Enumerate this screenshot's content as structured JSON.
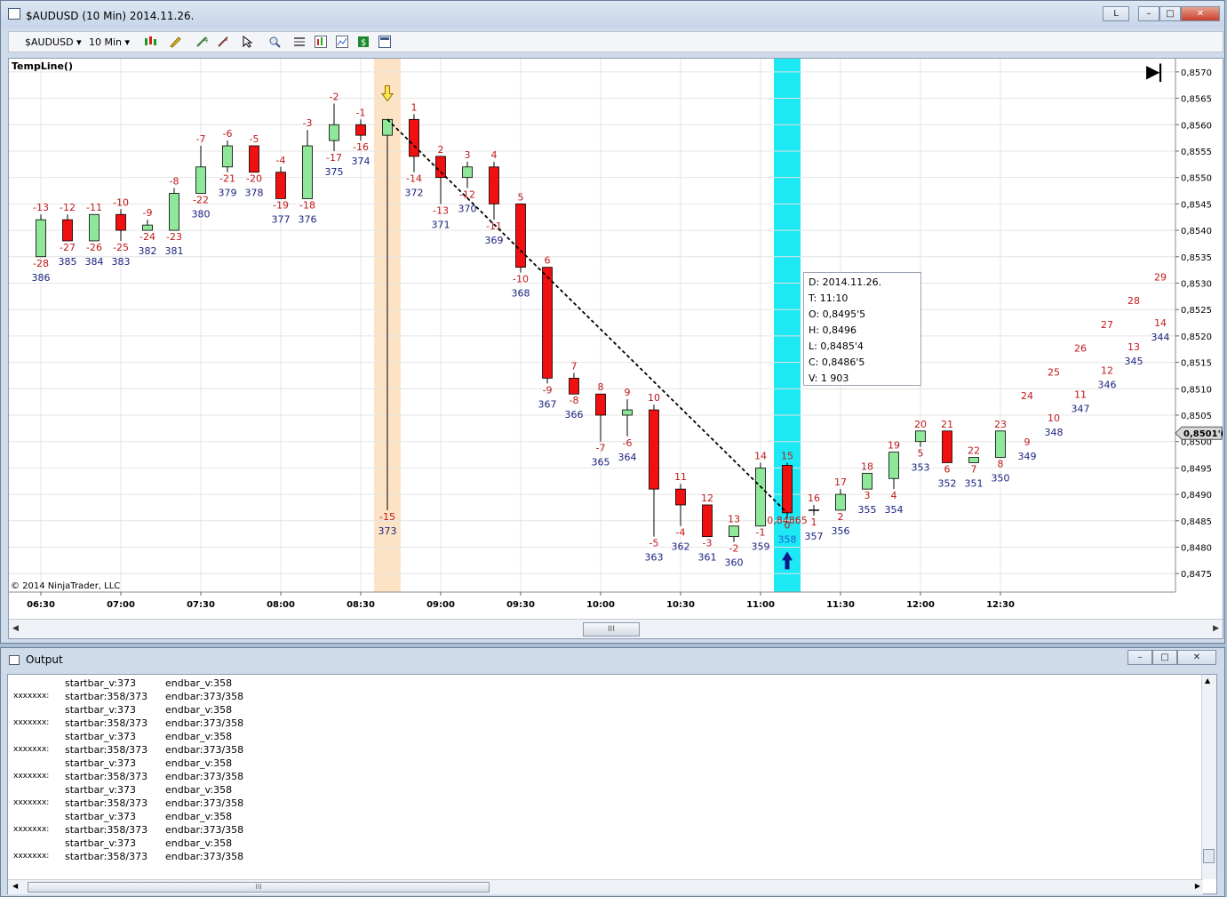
{
  "window": {
    "title": "$AUDUSD (10 Min)  2014.11.26.",
    "badge": "L",
    "minimize": "–",
    "maximize": "□",
    "close": "✕"
  },
  "toolbar": {
    "instrument": "$AUDUSD",
    "interval": "10 Min",
    "icons": [
      "candlestick-icon",
      "pencil-icon",
      "zoom-in-icon",
      "zoom-out-icon",
      "cursor-icon",
      "magnifier-icon",
      "properties-icon",
      "bars-icon",
      "indicator-icon",
      "strategy-icon",
      "dollar-icon",
      "data-box-icon"
    ]
  },
  "chart": {
    "indicator": "TempLine()",
    "copyright": "© 2014 NinjaTrader, LLC",
    "go_to_end": "▶|",
    "scroll_grip": "III",
    "info_box": [
      "D: 2014.11.26.",
      "T: 11:10",
      "O: 0,8495'5",
      "H: 0,8496",
      "L: 0,8485'4",
      "C: 0,8486'5",
      "V: 1 903"
    ],
    "line_label": "0,84865",
    "price_marker": "0,8501'6"
  },
  "chart_data": {
    "type": "candlestick",
    "x_labels": [
      "06:30",
      "07:00",
      "07:30",
      "08:00",
      "08:30",
      "09:00",
      "09:30",
      "10:00",
      "10:30",
      "11:00",
      "11:30",
      "12:00",
      "12:30"
    ],
    "y_ticks": [
      "0,8570",
      "0,8565",
      "0,8560",
      "0,8555",
      "0,8550",
      "0,8545",
      "0,8540",
      "0,8535",
      "0,8530",
      "0,8525",
      "0,8520",
      "0,8515",
      "0,8510",
      "0,8505",
      "0,8500",
      "0,8495",
      "0,8490",
      "0,8485",
      "0,8480",
      "0,8475"
    ],
    "ylim": [
      0.84715,
      0.85725
    ],
    "grid": true,
    "bars": [
      {
        "bar": 386,
        "o": 0.8535,
        "h": 0.8543,
        "l": 0.8535,
        "c": 0.8542,
        "top": "-13",
        "bot": "-28"
      },
      {
        "bar": 385,
        "o": 0.8542,
        "h": 0.8543,
        "l": 0.8538,
        "c": 0.8538,
        "top": "-12",
        "bot": "-27"
      },
      {
        "bar": 384,
        "o": 0.8538,
        "h": 0.8543,
        "l": 0.8538,
        "c": 0.8543,
        "top": "-11",
        "bot": "-26"
      },
      {
        "bar": 383,
        "o": 0.8543,
        "h": 0.8544,
        "l": 0.8538,
        "c": 0.854,
        "top": "-10",
        "bot": "-25"
      },
      {
        "bar": 382,
        "o": 0.854,
        "h": 0.8542,
        "l": 0.854,
        "c": 0.8541,
        "top": "-9",
        "bot": "-24"
      },
      {
        "bar": 381,
        "o": 0.854,
        "h": 0.8548,
        "l": 0.854,
        "c": 0.8547,
        "top": "-8",
        "bot": "-23"
      },
      {
        "bar": 380,
        "o": 0.8547,
        "h": 0.8556,
        "l": 0.8547,
        "c": 0.8552,
        "top": "-7",
        "bot": "-22"
      },
      {
        "bar": 379,
        "o": 0.8552,
        "h": 0.8557,
        "l": 0.8551,
        "c": 0.8556,
        "top": "-6",
        "bot": "-21"
      },
      {
        "bar": 378,
        "o": 0.8556,
        "h": 0.8556,
        "l": 0.8551,
        "c": 0.8551,
        "top": "-5",
        "bot": "-20"
      },
      {
        "bar": 377,
        "o": 0.8551,
        "h": 0.8552,
        "l": 0.8546,
        "c": 0.8546,
        "top": "-4",
        "bot": "-19"
      },
      {
        "bar": 376,
        "o": 0.8546,
        "h": 0.8559,
        "l": 0.8546,
        "c": 0.8556,
        "top": "-3",
        "bot": "-18"
      },
      {
        "bar": 375,
        "o": 0.8557,
        "h": 0.8564,
        "l": 0.8555,
        "c": 0.856,
        "top": "-2",
        "bot": "-17"
      },
      {
        "bar": 374,
        "o": 0.856,
        "h": 0.8561,
        "l": 0.8557,
        "c": 0.8558,
        "top": "-1",
        "bot": "-16"
      },
      {
        "bar": 373,
        "o": 0.8558,
        "h": 0.8561,
        "l": 0.8487,
        "c": 0.8561,
        "top": "",
        "bot": "-15"
      },
      {
        "bar": 372,
        "o": 0.8561,
        "h": 0.8562,
        "l": 0.8551,
        "c": 0.8554,
        "top": "1",
        "bot": "-14"
      },
      {
        "bar": 371,
        "o": 0.8554,
        "h": 0.8554,
        "l": 0.8545,
        "c": 0.855,
        "top": "2",
        "bot": "-13"
      },
      {
        "bar": 370,
        "o": 0.855,
        "h": 0.8553,
        "l": 0.8548,
        "c": 0.8552,
        "top": "3",
        "bot": "-12"
      },
      {
        "bar": 369,
        "o": 0.8552,
        "h": 0.8553,
        "l": 0.8542,
        "c": 0.8545,
        "top": "4",
        "bot": "-11"
      },
      {
        "bar": 368,
        "o": 0.8545,
        "h": 0.8545,
        "l": 0.8532,
        "c": 0.8533,
        "top": "5",
        "bot": "-10"
      },
      {
        "bar": 367,
        "o": 0.8533,
        "h": 0.8533,
        "l": 0.8511,
        "c": 0.8512,
        "top": "6",
        "bot": "-9"
      },
      {
        "bar": 366,
        "o": 0.8512,
        "h": 0.8513,
        "l": 0.8509,
        "c": 0.8509,
        "top": "7",
        "bot": "-8"
      },
      {
        "bar": 365,
        "o": 0.8509,
        "h": 0.8509,
        "l": 0.85,
        "c": 0.8505,
        "top": "8",
        "bot": "-7"
      },
      {
        "bar": 364,
        "o": 0.8505,
        "h": 0.8508,
        "l": 0.8501,
        "c": 0.8506,
        "top": "9",
        "bot": "-6"
      },
      {
        "bar": 363,
        "o": 0.8506,
        "h": 0.8507,
        "l": 0.8482,
        "c": 0.8491,
        "top": "10",
        "bot": "-5"
      },
      {
        "bar": 362,
        "o": 0.8491,
        "h": 0.8492,
        "l": 0.8484,
        "c": 0.8488,
        "top": "11",
        "bot": "-4"
      },
      {
        "bar": 361,
        "o": 0.8488,
        "h": 0.8488,
        "l": 0.8482,
        "c": 0.8482,
        "top": "12",
        "bot": "-3"
      },
      {
        "bar": 360,
        "o": 0.8482,
        "h": 0.8484,
        "l": 0.8481,
        "c": 0.8484,
        "top": "13",
        "bot": "-2"
      },
      {
        "bar": 359,
        "o": 0.8484,
        "h": 0.8496,
        "l": 0.8484,
        "c": 0.8495,
        "top": "14",
        "bot": "-1"
      },
      {
        "bar": 358,
        "o": 0.84955,
        "h": 0.8496,
        "l": 0.84854,
        "c": 0.84865,
        "top": "15",
        "bot": "0"
      },
      {
        "bar": 357,
        "o": 0.8487,
        "h": 0.8488,
        "l": 0.8486,
        "c": 0.8487,
        "top": "16",
        "bot": "1"
      },
      {
        "bar": 356,
        "o": 0.8487,
        "h": 0.8491,
        "l": 0.8487,
        "c": 0.849,
        "top": "17",
        "bot": "2"
      },
      {
        "bar": 355,
        "o": 0.8491,
        "h": 0.8494,
        "l": 0.8491,
        "c": 0.8494,
        "top": "18",
        "bot": "3"
      },
      {
        "bar": 354,
        "o": 0.8493,
        "h": 0.8498,
        "l": 0.8491,
        "c": 0.8498,
        "top": "19",
        "bot": "4"
      },
      {
        "bar": 353,
        "o": 0.85,
        "h": 0.8502,
        "l": 0.8499,
        "c": 0.8502,
        "top": "20",
        "bot": "5"
      },
      {
        "bar": 352,
        "o": 0.8502,
        "h": 0.8502,
        "l": 0.8496,
        "c": 0.8496,
        "top": "21",
        "bot": "6"
      },
      {
        "bar": 351,
        "o": 0.8496,
        "h": 0.8497,
        "l": 0.8496,
        "c": 0.8497,
        "top": "22",
        "bot": "7"
      },
      {
        "bar": 350,
        "o": 0.8497,
        "h": 0.8502,
        "l": 0.8497,
        "c": 0.8502,
        "top": "23",
        "bot": "8"
      }
    ],
    "future": [
      {
        "bar": "349",
        "top": "24",
        "bot": "9"
      },
      {
        "bar": "348",
        "top": "25",
        "bot": "10"
      },
      {
        "bar": "347",
        "top": "26",
        "bot": "11"
      },
      {
        "bar": "346",
        "top": "27",
        "bot": "12"
      },
      {
        "bar": "345",
        "top": "28",
        "bot": "13"
      },
      {
        "bar": "344",
        "top": "29",
        "bot": "14"
      }
    ],
    "trend_line": {
      "from_bar": 373,
      "from_price": 0.8561,
      "to_bar": 358,
      "to_price": 0.84865
    },
    "highlight_bars": [
      {
        "bar": 373,
        "color": "#fde3c6"
      },
      {
        "bar": 358,
        "color": "#1de9f5"
      }
    ],
    "last_price": 0.85016
  },
  "output": {
    "title": "Output",
    "lines": [
      [
        "",
        "startbar_v:373",
        "endbar_v:358"
      ],
      [
        "xxxxxxx:",
        "startbar:358/373",
        "endbar:373/358"
      ],
      [
        "",
        "startbar_v:373",
        "endbar_v:358"
      ],
      [
        "xxxxxxx:",
        "startbar:358/373",
        "endbar:373/358"
      ],
      [
        "",
        "startbar_v:373",
        "endbar_v:358"
      ],
      [
        "xxxxxxx:",
        "startbar:358/373",
        "endbar:373/358"
      ],
      [
        "",
        "startbar_v:373",
        "endbar_v:358"
      ],
      [
        "xxxxxxx:",
        "startbar:358/373",
        "endbar:373/358"
      ],
      [
        "",
        "startbar_v:373",
        "endbar_v:358"
      ],
      [
        "xxxxxxx:",
        "startbar:358/373",
        "endbar:373/358"
      ],
      [
        "",
        "startbar_v:373",
        "endbar_v:358"
      ],
      [
        "xxxxxxx:",
        "startbar:358/373",
        "endbar:373/358"
      ],
      [
        "",
        "startbar_v:373",
        "endbar_v:358"
      ],
      [
        "xxxxxxx:",
        "startbar:358/373",
        "endbar:373/358"
      ]
    ]
  }
}
